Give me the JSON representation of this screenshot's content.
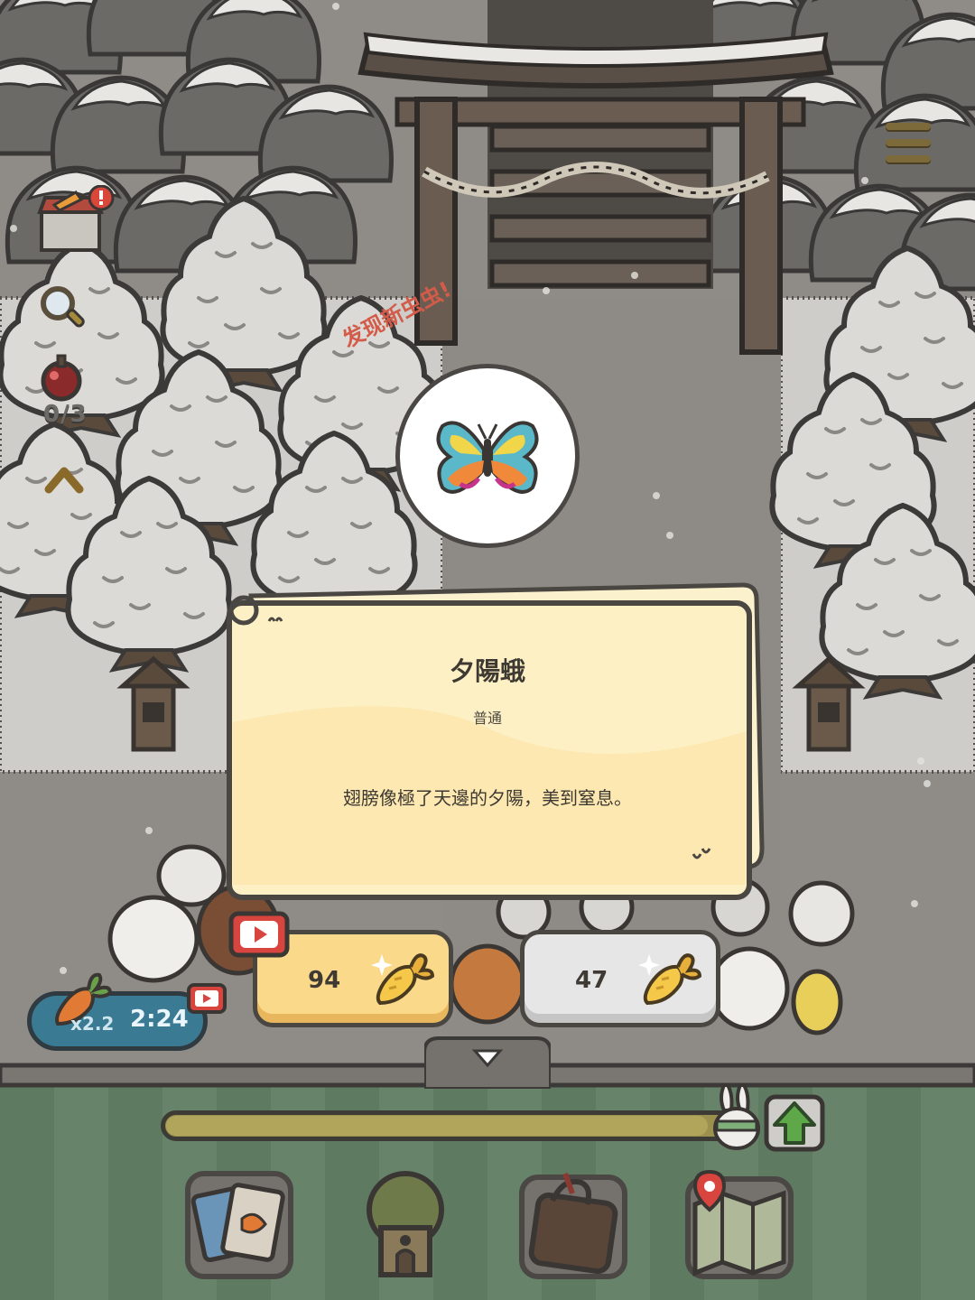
{
  "hud": {
    "counter": "0/3",
    "boost": {
      "multiplier": "x2.2",
      "time": "2:24"
    }
  },
  "discovery": {
    "banner": "发现新虫虫!",
    "bug": {
      "name": "夕陽蛾",
      "rarity": "普通",
      "description": "翅膀像極了天邊的夕陽，美到窒息。"
    }
  },
  "rewards": {
    "ad_reward": {
      "amount": "94"
    },
    "claim": {
      "amount": "47"
    }
  },
  "progress": {
    "level_fraction": 0.94
  },
  "colors": {
    "card": "#fdf0c4",
    "ad_button": "#fbd98a",
    "claim_button": "#e6e6e6",
    "banner_text": "#d35b4a",
    "bottom_stripes": [
      "#5e7a60",
      "#67846a"
    ]
  },
  "icons": [
    "hamburger-menu-icon",
    "shop-stall-icon",
    "magnifier-icon",
    "bomb-icon",
    "chevron-up-icon",
    "video-icon",
    "carrot-icon",
    "upgrade-arrow-icon",
    "card-deck-icon",
    "tree-house-icon",
    "backpack-icon",
    "map-icon"
  ]
}
